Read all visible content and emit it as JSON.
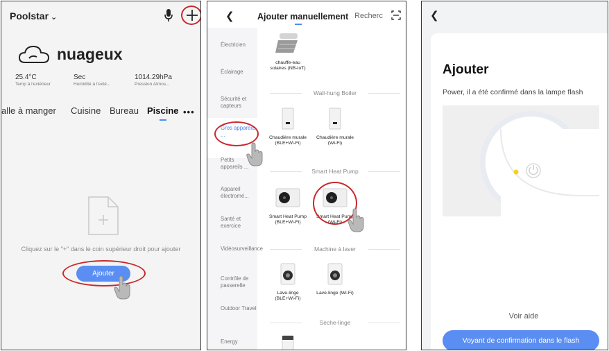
{
  "panel1": {
    "home_name": "Poolstar",
    "weather": {
      "condition": "nuageux",
      "temperature": "25.4°C",
      "temperature_label": "Temp à l'extérieur",
      "humidity": "Sec",
      "humidity_label": "Humidité à l'exté...",
      "pressure": "1014.29hPa",
      "pressure_label": "Pression Atmos..."
    },
    "tabs": [
      "alle à manger",
      "Cuisine",
      "Bureau",
      "Piscine"
    ],
    "active_tab": "Piscine",
    "empty_message": "Cliquez sur le \"+\" dans le coin supérieur droit pour ajouter",
    "add_button": "Ajouter",
    "icons": [
      "chevron-down-icon",
      "microphone-icon",
      "plus-icon",
      "cloud-icon",
      "more-icon",
      "empty-document-icon",
      "hand-pointer-icon"
    ]
  },
  "panel2": {
    "title": "Ajouter manuellement",
    "search_tab": "Recherc",
    "sidebar": [
      "Électricien",
      "Éclairage",
      "Sécurité et capteurs",
      "Gros appareils ...",
      "Petits appareils ...",
      "Appareil électromé...",
      "Santé et exercice",
      "Vidéosurveillance",
      "Contrôle de passerelle",
      "Outdoor Travel",
      "Energy"
    ],
    "active_sidebar": "Gros appareils ...",
    "top_product": "chauffe-eau solaires (NB-IoT)",
    "sections": [
      {
        "title": "Wall-hung Boiler",
        "products": [
          "Chaudière murale (BLE+Wi-Fi)",
          "Chaudière murale (Wi-Fi)"
        ]
      },
      {
        "title": "Smart Heat Pump",
        "products": [
          "Smart Heat Pump (BLE+Wi-Fi)",
          "Smart Heat Pump (Wi-Fi)"
        ]
      },
      {
        "title": "Machine à laver",
        "products": [
          "Lave-linge (BLE+Wi-Fi)",
          "Lave-linge (Wi-Fi)"
        ]
      },
      {
        "title": "Sèche-linge",
        "products": []
      }
    ]
  },
  "panel3": {
    "title": "Ajouter",
    "description": "Power, il a été confirmé dans la lampe flash",
    "help_link": "Voir aide",
    "confirm_button": "Voyant de confirmation dans le flash"
  },
  "colors": {
    "accent": "#5b8ef2",
    "highlight_circle": "#c8282d",
    "indicator_yellow": "#f5d21f"
  }
}
